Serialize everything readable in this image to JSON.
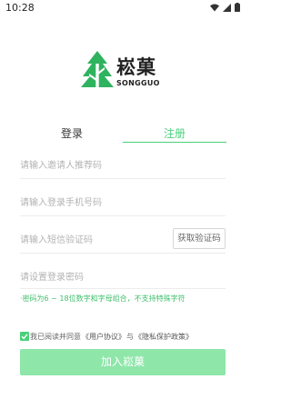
{
  "status_bar": {
    "time": "10:28",
    "icons": [
      "wifi-icon",
      "signal-icon",
      "battery-icon"
    ]
  },
  "logo": {
    "title": "崧菓",
    "subtitle": "SONGGUO",
    "icon": "tree-icon",
    "accent_color": "#2fb35f"
  },
  "tabs": {
    "login_label": "登录",
    "register_label": "注册",
    "active": "register",
    "active_color": "#4ad07b"
  },
  "form": {
    "invite_placeholder": "请输入邀请人推荐码",
    "phone_placeholder": "请输入登录手机号码",
    "sms_placeholder": "请输入短信验证码",
    "get_code_label": "获取验证码",
    "password_placeholder": "请设置登录密码",
    "password_hint": "·密码为6 ~ 18位数字和字母组合，不支持特殊字符"
  },
  "agreement": {
    "checked": true,
    "prefix": "我已阅读并同意",
    "user_agreement": "《用户协议》",
    "conjunction": "与",
    "privacy_policy": "《隐私保护政策》"
  },
  "submit": {
    "label": "加入崧菓",
    "color": "#8ee6a9"
  }
}
